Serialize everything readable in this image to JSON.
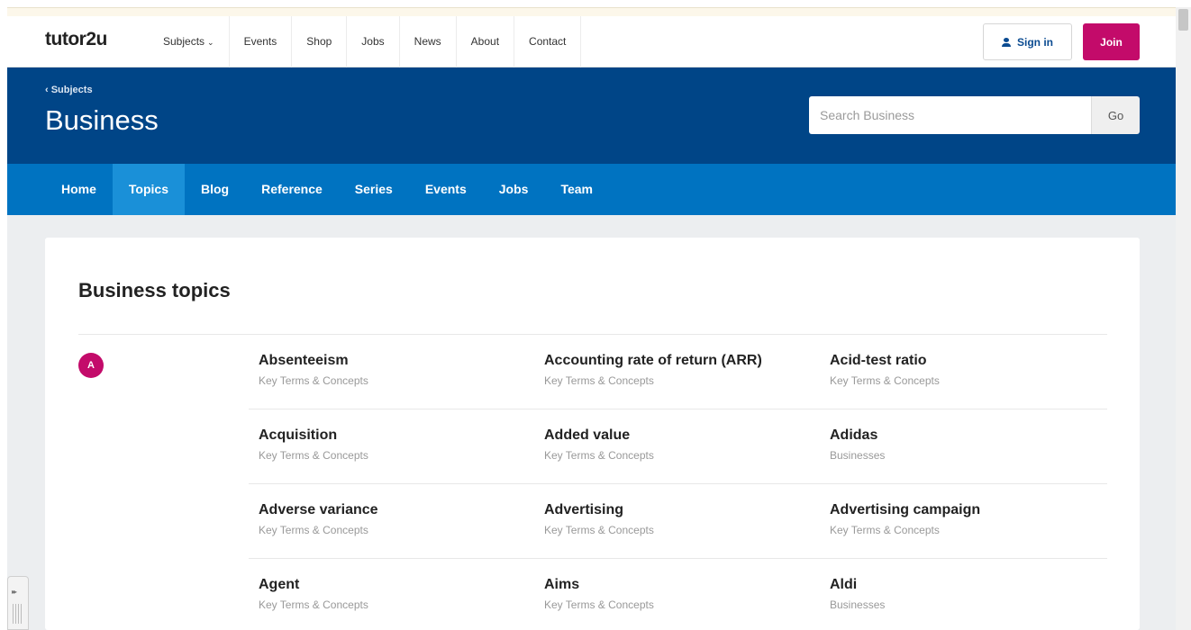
{
  "nav": {
    "logo": "tutor2u",
    "links": [
      "Subjects",
      "Events",
      "Shop",
      "Jobs",
      "News",
      "About",
      "Contact"
    ],
    "sign_in": "Sign in",
    "join": "Join"
  },
  "hero": {
    "breadcrumb": "‹ Subjects",
    "title": "Business",
    "search_placeholder": "Search Business",
    "go": "Go"
  },
  "subnav": {
    "tabs": [
      "Home",
      "Topics",
      "Blog",
      "Reference",
      "Series",
      "Events",
      "Jobs",
      "Team"
    ],
    "active": "Topics"
  },
  "topics": {
    "title": "Business topics",
    "letter": "A",
    "rows": [
      [
        {
          "name": "Absenteeism",
          "category": "Key Terms & Concepts"
        },
        {
          "name": "Accounting rate of return (ARR)",
          "category": "Key Terms & Concepts"
        },
        {
          "name": "Acid-test ratio",
          "category": "Key Terms & Concepts"
        }
      ],
      [
        {
          "name": "Acquisition",
          "category": "Key Terms & Concepts"
        },
        {
          "name": "Added value",
          "category": "Key Terms & Concepts"
        },
        {
          "name": "Adidas",
          "category": "Businesses"
        }
      ],
      [
        {
          "name": "Adverse variance",
          "category": "Key Terms & Concepts"
        },
        {
          "name": "Advertising",
          "category": "Key Terms & Concepts"
        },
        {
          "name": "Advertising campaign",
          "category": "Key Terms & Concepts"
        }
      ],
      [
        {
          "name": "Agent",
          "category": "Key Terms & Concepts"
        },
        {
          "name": "Aims",
          "category": "Key Terms & Concepts"
        },
        {
          "name": "Aldi",
          "category": "Businesses"
        }
      ]
    ]
  },
  "colors": {
    "brand_blue": "#004587",
    "subnav_blue": "#0073c1",
    "active_tab": "#1a90d8",
    "accent_magenta": "#c30b6a"
  }
}
